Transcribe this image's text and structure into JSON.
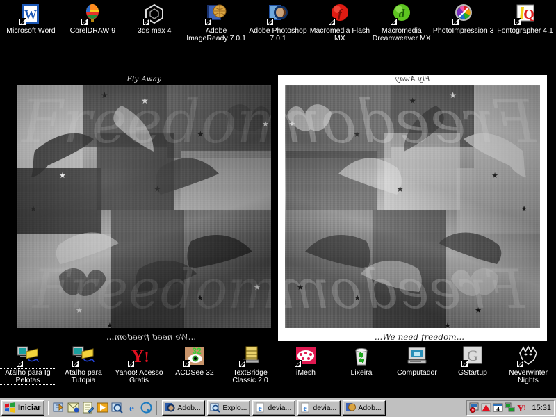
{
  "desktop": {
    "background_color": "#000000",
    "top_icons": [
      {
        "label": "Microsoft Word",
        "icon": "microsoft-word-icon",
        "shortcut": true,
        "selected": false
      },
      {
        "label": "CorelDRAW 9",
        "icon": "coreldraw-balloon-icon",
        "shortcut": true,
        "selected": false
      },
      {
        "label": "3ds max 4",
        "icon": "3ds-max-cube-icon",
        "shortcut": true,
        "selected": false
      },
      {
        "label": "Adobe ImageReady 7.0.1",
        "icon": "adobe-imageready-icon",
        "shortcut": true,
        "selected": false
      },
      {
        "label": "Adobe Photoshop 7.0.1",
        "icon": "adobe-photoshop-icon",
        "shortcut": true,
        "selected": false
      },
      {
        "label": "Macromedia Flash MX",
        "icon": "macromedia-flash-icon",
        "shortcut": true,
        "selected": false
      },
      {
        "label": "Macromedia Dreamweaver MX",
        "icon": "macromedia-dreamweaver-icon",
        "shortcut": true,
        "selected": false
      },
      {
        "label": "PhotoImpression 3",
        "icon": "photoimpression-icon",
        "shortcut": true,
        "selected": false
      },
      {
        "label": "Fontographer 4.1",
        "icon": "fontographer-icon",
        "shortcut": true,
        "selected": false
      }
    ],
    "bottom_icons": [
      {
        "label": "Atalho para Ig Pelotas",
        "icon": "dialup-connection-icon",
        "shortcut": true,
        "selected": true
      },
      {
        "label": "Atalho para Tutopia",
        "icon": "dialup-connection-icon",
        "shortcut": true,
        "selected": false
      },
      {
        "label": "Yahoo! Acesso Gratis",
        "icon": "yahoo-icon",
        "shortcut": true,
        "selected": false
      },
      {
        "label": "ACDSee 32",
        "icon": "acdsee-eye-icon",
        "shortcut": true,
        "selected": false
      },
      {
        "label": "TextBridge Classic 2.0",
        "icon": "textbridge-icon",
        "shortcut": true,
        "selected": false
      },
      {
        "label": "iMesh",
        "icon": "imesh-icon",
        "shortcut": true,
        "selected": false
      },
      {
        "label": "Lixeira",
        "icon": "recycle-bin-icon",
        "shortcut": false,
        "selected": false
      },
      {
        "label": "Computador",
        "icon": "my-computer-icon",
        "shortcut": false,
        "selected": false
      },
      {
        "label": "GStartup",
        "icon": "gstartup-icon",
        "shortcut": true,
        "selected": false
      },
      {
        "label": "Neverwinter Nights",
        "icon": "neverwinter-nights-icon",
        "shortcut": true,
        "selected": false
      }
    ]
  },
  "artwork": {
    "left_panel": {
      "frame_color": "#000000",
      "title": "Fly Away",
      "caption": "...We need freedom...",
      "script_overlay": "Freedom"
    },
    "right_panel": {
      "frame_color": "#ffffff",
      "title": "Fly Away",
      "caption": "...We need freedom...",
      "script_overlay": "Freedom"
    }
  },
  "taskbar": {
    "start_label": "Iniciar",
    "start_icon": "windows-flag-icon",
    "quick_launch": [
      {
        "name": "show-desktop-icon"
      },
      {
        "name": "outlook-express-icon"
      },
      {
        "name": "notepad-icon"
      },
      {
        "name": "media-player-icon"
      },
      {
        "name": "search-icon"
      },
      {
        "name": "internet-explorer-icon"
      },
      {
        "name": "quicktime-icon"
      }
    ],
    "task_buttons": [
      {
        "label": "Adob...",
        "icon": "adobe-photoshop-icon"
      },
      {
        "label": "Explo...",
        "icon": "windows-explorer-icon"
      },
      {
        "label": "devia...",
        "icon": "internet-explorer-icon"
      },
      {
        "label": "devia...",
        "icon": "internet-explorer-icon"
      },
      {
        "label": "Adob...",
        "icon": "adobe-imageready-icon"
      }
    ],
    "tray_icons": [
      {
        "name": "task-scheduler-icon"
      },
      {
        "name": "acrobat-reader-icon"
      },
      {
        "name": "calendar-icon"
      },
      {
        "name": "network-connection-icon"
      },
      {
        "name": "yahoo-messenger-icon"
      }
    ],
    "clock": "15:31"
  }
}
